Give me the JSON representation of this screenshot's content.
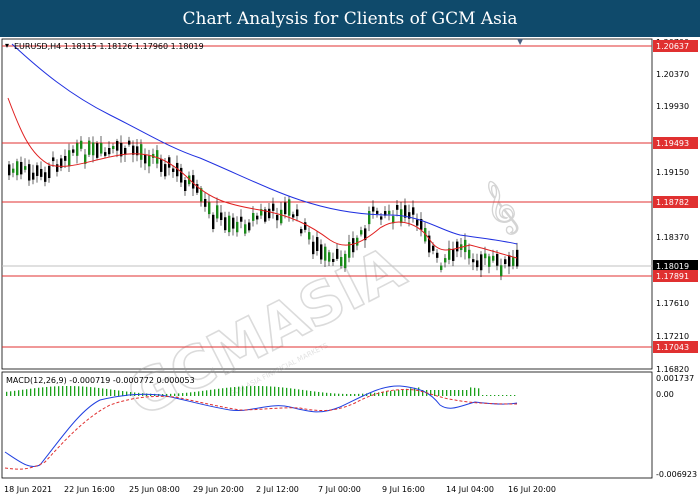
{
  "header": {
    "title": "Chart Analysis for Clients of GCM Asia"
  },
  "main_chart": {
    "symbol_info": "EURUSD,H4  1.18115 1.18126 1.17960 1.18019",
    "price_ticks": [
      "1.20700",
      "1.20370",
      "1.19930",
      "1.19150",
      "1.18370",
      "1.17610",
      "1.17210",
      "1.16820"
    ],
    "horizontal_levels": [
      "1.20637",
      "1.19493",
      "1.18782",
      "1.17891",
      "1.17043"
    ],
    "level_color": "#e03030",
    "current_price": "1.18019",
    "watermark": "GCMASIA",
    "watermark_sub": "GCM ASIA FINANCIAL MARKETS"
  },
  "macd_panel": {
    "label": "MACD(12,26,9) -0.000719 -0.000772 0.000053",
    "ticks": [
      "0.001737",
      "0.00",
      "-0.006923"
    ]
  },
  "x_axis": {
    "labels": [
      "18 Jun 2021",
      "22 Jun 16:00",
      "25 Jun 08:00",
      "29 Jun 20:00",
      "2 Jul 12:00",
      "7 Jul 00:00",
      "9 Jul 16:00",
      "14 Jul 04:00",
      "16 Jul 20:00"
    ]
  },
  "colors": {
    "header_bg": "#0f4a6b",
    "ma_blue": "#2030e0",
    "ma_red": "#e02020",
    "candle_green": "#1a8a1a",
    "candle_black": "#000000",
    "macd_hist": "#1aa01a",
    "macd_line": "#2040e0",
    "macd_signal": "#e03030"
  }
}
